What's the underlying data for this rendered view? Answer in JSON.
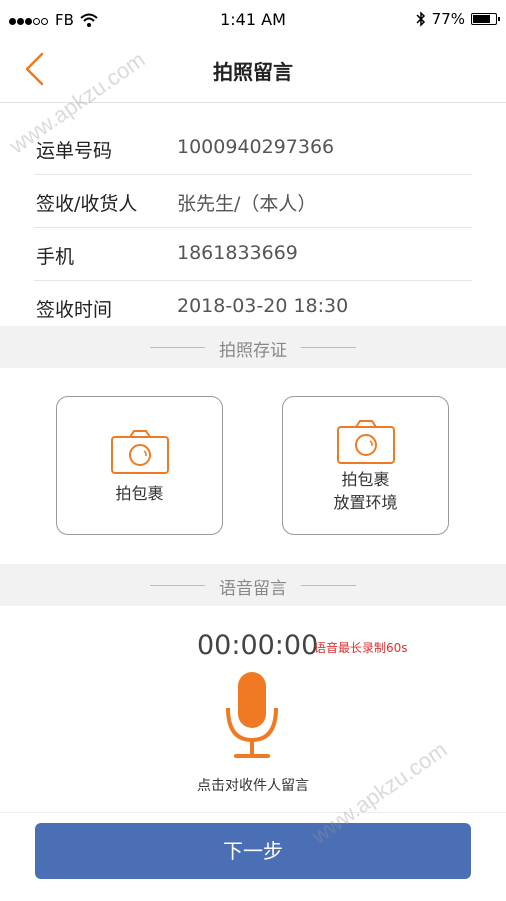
{
  "status_bar": {
    "carrier": "FB",
    "time": "1:41 AM",
    "battery": "77%",
    "battery_level": 0.77,
    "icons": [
      "signal-dots",
      "wifi-icon",
      "bluetooth-icon",
      "battery-icon"
    ]
  },
  "nav": {
    "title": "拍照留言",
    "back_icon": "chevron-left-icon"
  },
  "info": {
    "rows": [
      {
        "label": "运单号码",
        "value": "1000940297366"
      },
      {
        "label": "签收/收货人",
        "value": "张先生/（本人）"
      },
      {
        "label": "手机",
        "value": "1861833669"
      },
      {
        "label": "签收时间",
        "value": "2018-03-20   18:30"
      }
    ]
  },
  "photo_section": {
    "title": "拍照存证",
    "cards": [
      {
        "label_line1": "拍包裹",
        "label_line2": ""
      },
      {
        "label_line1": "拍包裹",
        "label_line2": "放置环境"
      }
    ]
  },
  "voice_section": {
    "title": "语音留言",
    "timer": "00:00:00",
    "limit_note": "语音最长录制60s",
    "hint": "点击对收件人留言"
  },
  "next_button": "下一步",
  "watermarks": [
    "www.apkzu.com",
    "www.apkzu.com"
  ],
  "colors": {
    "accent": "#f07a23",
    "primary_button": "#4a6fb5",
    "limit_text": "#e0312f",
    "section_bg": "#f2f2f2"
  }
}
